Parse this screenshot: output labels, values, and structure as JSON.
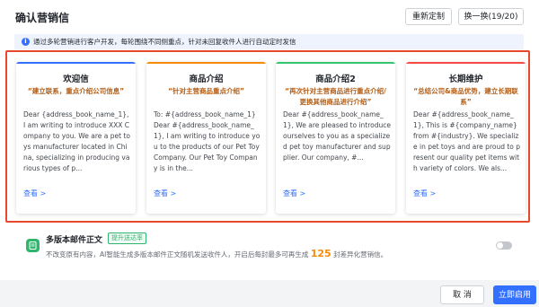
{
  "header": {
    "title": "确认营销信",
    "regen_label": "重新定制",
    "swap_label": "换一换(19/20)"
  },
  "info": {
    "icon": "info-icon",
    "text": "通过多轮营销进行客户开发，每轮围绕不同侧重点，针对未回复收件人进行自动定时发信"
  },
  "cards": [
    {
      "title": "欢迎信",
      "subtitle": "“建立联系，重点介绍公司信息”",
      "accent": "#3370ff",
      "body": "Dear {address_book_name_1}, I am writing to introduce XXX Company to you. We are a pet toys manufacturer located in China, specializing in producing various types of p...",
      "more": "查看 >"
    },
    {
      "title": "商品介绍",
      "subtitle": "“针对主营商品重点介绍”",
      "accent": "#f58a0b",
      "body": "To: #{address_book_name_1} Dear #{address_book_name_1}, I am writing to introduce you to the products of our Pet Toy Company. Our Pet Toy Company is in the...",
      "more": "查看 >"
    },
    {
      "title": "商品介绍2",
      "subtitle": "“再次针对主营商品进行重点介绍/更换其他商品进行介绍”",
      "accent": "#34c46e",
      "body": "Dear #{address_book_name_1}, We are pleased to introduce ourselves to you as a specialized pet toy manufacturer and supplier. Our company, #...",
      "more": "查看 >"
    },
    {
      "title": "长期维护",
      "subtitle": "“总结公司&商品优势，建立长期联系”",
      "accent": "#f54a45",
      "body": "Dear #{address_book_name_1}, This is #{company_name} from #{industry}. We specialize in pet toys and are proud to present our quality pet items with variety of colors. We als...",
      "more": "查看 >"
    }
  ],
  "multi_version": {
    "title": "多版本邮件正文",
    "tag": "提升送达率",
    "desc_prefix": "不改变原有内容，AI智能生成多版本邮件正文随机发送收件人，开启后每封最多可再生成",
    "count": "125",
    "desc_suffix": "封差异化营销信。",
    "toggle_on": false
  },
  "footer": {
    "cancel_label": "取 消",
    "enable_label": "立即启用"
  }
}
